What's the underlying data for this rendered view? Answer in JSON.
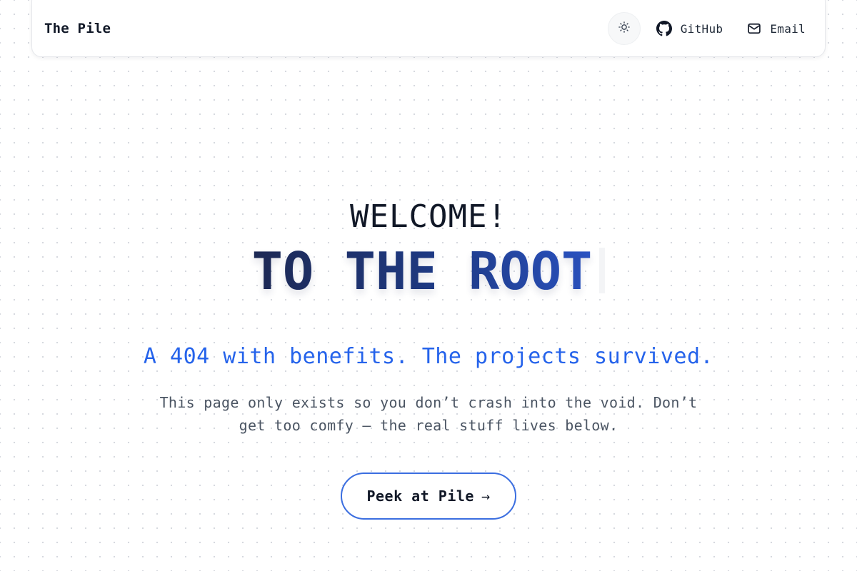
{
  "header": {
    "brand": "The Pile",
    "theme_toggle_icon": "sun-icon",
    "links": [
      {
        "label": "GitHub",
        "icon": "github-icon"
      },
      {
        "label": "Email",
        "icon": "mail-icon"
      }
    ]
  },
  "hero": {
    "welcome": "WELCOME!",
    "headline": "TO THE ROOT",
    "tagline": "A 404 with benefits. The projects survived.",
    "description": "This page only exists so you don’t crash into the void. Don’t get too comfy — the real stuff lives below.",
    "cta_label": "Peek at Pile",
    "cta_arrow": "→"
  },
  "colors": {
    "accent": "#2563eb",
    "headline_dark": "#1e2a55",
    "headline_light": "#2b55c7",
    "button_border": "#3b6ee0"
  }
}
